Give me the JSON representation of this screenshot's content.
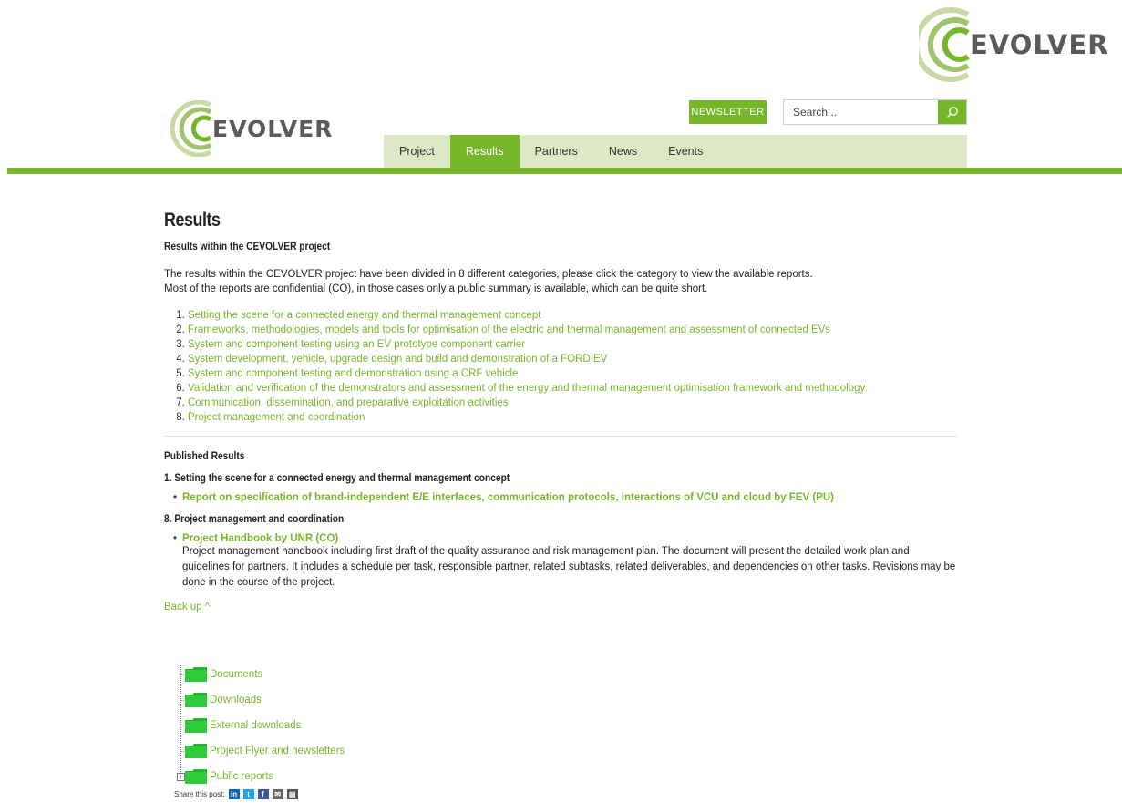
{
  "logo_top": {
    "text": "EVOLVER"
  },
  "header": {
    "logo_text": "EVOLVER",
    "newsletter_label": "NEWSLETTER",
    "search_placeholder": "Search..."
  },
  "nav": {
    "items": [
      {
        "label": "Project",
        "active": false
      },
      {
        "label": "Results",
        "active": true
      },
      {
        "label": "Partners",
        "active": false
      },
      {
        "label": "News",
        "active": false
      },
      {
        "label": "Events",
        "active": false
      }
    ]
  },
  "main": {
    "title": "Results",
    "subtitle": "Results within the CEVOLVER project",
    "intro_line1": "The results within the CEVOLVER project have been divided in 8 different categories, please click the category to view the available reports.",
    "intro_line2": "Most of the reports are confidential (CO), in those cases only a public summary is available, which can be quite short.",
    "categories": [
      "Setting the scene for a connected energy and thermal management concept",
      "Frameworks, methodologies, models and tools for optimisation of the electric and thermal management and assessment of connected EVs",
      "System and component testing using an EV prototype component carrier",
      "System development, vehicle, upgrade design and build and demonstration of a FORD EV",
      "System and component testing and demonstration using a CRF vehicle",
      "Validation and verification of the demonstrators and assessment of the energy and thermal management optimisation framework and methodology",
      "Communication, dissemination, and preparative exploitation activities",
      "Project management and coordination"
    ],
    "published_heading": "Published Results",
    "sections": [
      {
        "heading": "1. Setting the scene for a connected energy and thermal management concept",
        "items": [
          {
            "title": "Report on specification of brand-independent E/E interfaces, communication protocols, interactions of VCU and cloud by FEV (PU)",
            "desc": ""
          }
        ]
      },
      {
        "heading": "8. Project management and coordination",
        "items": [
          {
            "title": "Project Handbook by UNR (CO)",
            "desc": "Project management handbook including first draft of the quality assurance and risk management plan. The document will present the detailed work plan and guidelines for partners. It includes a schedule per task, responsible partner, related subtasks, related deliverables, and dependencies on other tasks. Revisions may be done in the course of the project."
          }
        ]
      }
    ],
    "back_up": "Back up ^"
  },
  "tree": {
    "items": [
      "Documents",
      "Downloads",
      "External downloads",
      "Project Flyer and newsletters",
      "Public reports"
    ]
  },
  "share": {
    "label": "Share this post:",
    "icons": [
      "linkedin-icon",
      "twitter-icon",
      "facebook-icon",
      "email-icon",
      "print-icon"
    ]
  },
  "colors": {
    "accent": "#76b72a",
    "nav_bg": "#dde9c5"
  }
}
